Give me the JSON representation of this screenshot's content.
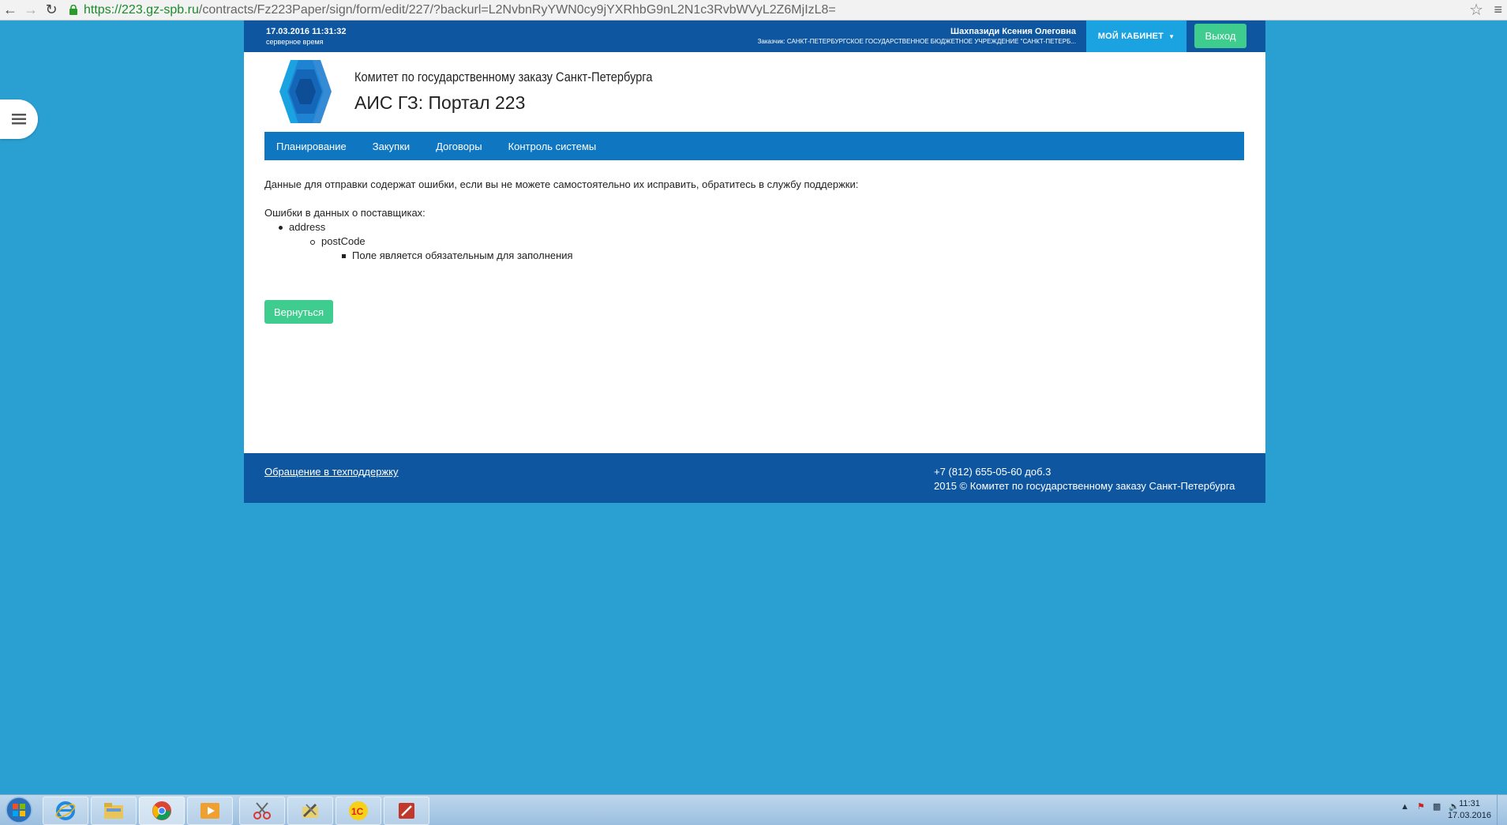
{
  "browser": {
    "url_scheme": "https://",
    "url_host": "223.gz-spb.ru",
    "url_rest": "/contracts/Fz223Paper/sign/form/edit/227/?backurl=L2NvbnRyYWN0cy9jYXRhbG9nL2N1c3RvbWVyL2Z6MjIzL8="
  },
  "topbar": {
    "server_time": "17.03.2016 11:31:32",
    "server_time_label": "серверное время",
    "user_name": "Шахпазиди Ксения Олеговна",
    "customer": "Заказчик: САНКТ-ПЕТЕРБУРГСКОЕ ГОСУДАРСТВЕННОЕ БЮДЖЕТНОЕ УЧРЕЖДЕНИЕ \"САНКТ-ПЕТЕРБ...",
    "cabinet_label": "МОЙ КАБИНЕТ",
    "logout_label": "Выход"
  },
  "header": {
    "committee": "Комитет по государственному заказу Санкт-Петербурга",
    "portal_title": "АИС ГЗ: Портал 223"
  },
  "nav": {
    "items": [
      {
        "label": "Планирование"
      },
      {
        "label": "Закупки"
      },
      {
        "label": "Договоры"
      },
      {
        "label": "Контроль системы"
      }
    ]
  },
  "main": {
    "error_intro": "Данные для отправки содержат ошибки, если вы не можете самостоятельно их исправить, обратитесь в службу поддержки:",
    "errors_heading": "Ошибки в данных о поставщиках:",
    "error_field": "address",
    "error_subfield": "postCode",
    "error_message": "Поле является обязательным для заполнения",
    "back_button": "Вернуться"
  },
  "footer": {
    "support_link": "Обращение в техподдержку",
    "phone": "+7 (812) 655-05-60 доб.3",
    "copyright": "2015 © Комитет по государственному заказу Санкт-Петербурга"
  },
  "taskbar": {
    "time": "11:31",
    "date": "17.03.2016"
  },
  "colors": {
    "page_bg": "#2aa0d2",
    "topbar": "#0e56a0",
    "nav": "#0f77c2",
    "accent_green": "#3ecd8e",
    "cabinet": "#1ba2e0"
  }
}
